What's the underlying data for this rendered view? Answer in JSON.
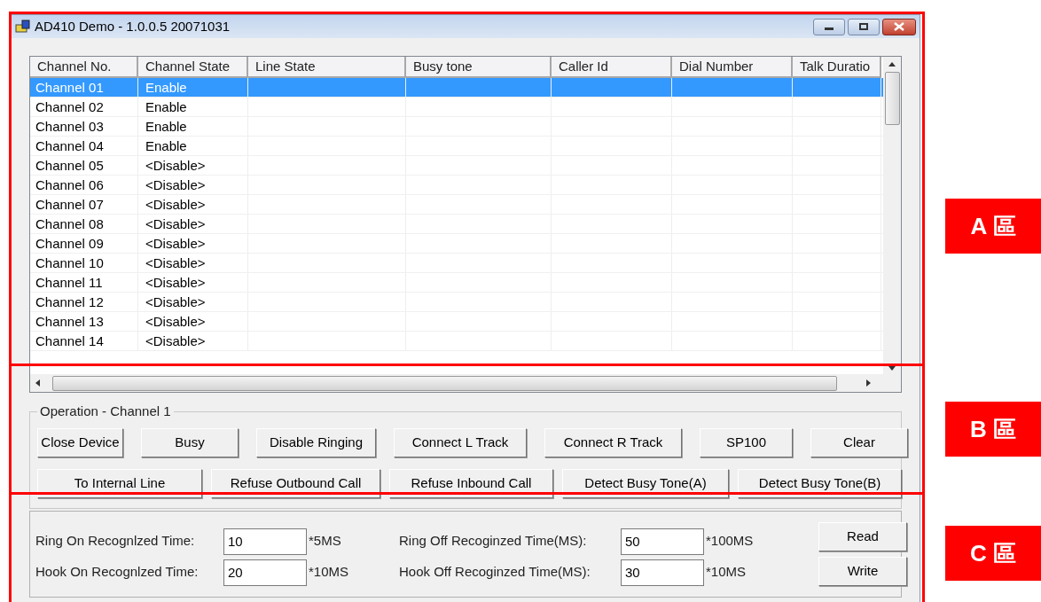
{
  "window": {
    "title": "AD410 Demo - 1.0.0.5 20071031"
  },
  "table": {
    "columns": [
      "Channel No.",
      "Channel State",
      "Line State",
      "Busy tone",
      "Caller Id",
      "Dial Number",
      "Talk Duratio"
    ],
    "rows": [
      {
        "channel": "Channel 01",
        "state": "Enable",
        "selected": true
      },
      {
        "channel": "Channel 02",
        "state": "Enable",
        "selected": false
      },
      {
        "channel": "Channel 03",
        "state": "Enable",
        "selected": false
      },
      {
        "channel": "Channel 04",
        "state": "Enable",
        "selected": false
      },
      {
        "channel": "Channel 05",
        "state": "<Disable>",
        "selected": false
      },
      {
        "channel": "Channel 06",
        "state": "<Disable>",
        "selected": false
      },
      {
        "channel": "Channel 07",
        "state": "<Disable>",
        "selected": false
      },
      {
        "channel": "Channel 08",
        "state": "<Disable>",
        "selected": false
      },
      {
        "channel": "Channel 09",
        "state": "<Disable>",
        "selected": false
      },
      {
        "channel": "Channel 10",
        "state": "<Disable>",
        "selected": false
      },
      {
        "channel": "Channel 11",
        "state": "<Disable>",
        "selected": false
      },
      {
        "channel": "Channel 12",
        "state": "<Disable>",
        "selected": false
      },
      {
        "channel": "Channel 13",
        "state": "<Disable>",
        "selected": false
      },
      {
        "channel": "Channel 14",
        "state": "<Disable>",
        "selected": false
      }
    ]
  },
  "operation": {
    "title": "Operation - Channel 1",
    "row_1": [
      "Close Device",
      "Busy",
      "Disable Ringing",
      "Connect L Track",
      "Connect R Track",
      "SP100",
      "Clear"
    ],
    "row_2": [
      "To Internal Line",
      "Refuse Outbound Call",
      "Refuse Inbound Call",
      "Detect Busy Tone(A)",
      "Detect Busy Tone(B)"
    ]
  },
  "settings": {
    "fields": [
      {
        "label": "Ring On Recognlzed Time:",
        "value": "10",
        "unit": "*5MS"
      },
      {
        "label": "Ring Off Recoginzed Time(MS):",
        "value": "50",
        "unit": "*100MS"
      },
      {
        "label": "Hook On Recognlzed Time:",
        "value": "20",
        "unit": "*10MS"
      },
      {
        "label": "Hook Off Recoginzed Time(MS):",
        "value": "30",
        "unit": "*10MS"
      }
    ],
    "buttons": [
      "Read",
      "Write"
    ]
  },
  "regions": [
    {
      "label": "A 區"
    },
    {
      "label": "B 區"
    },
    {
      "label": "C 區"
    }
  ]
}
